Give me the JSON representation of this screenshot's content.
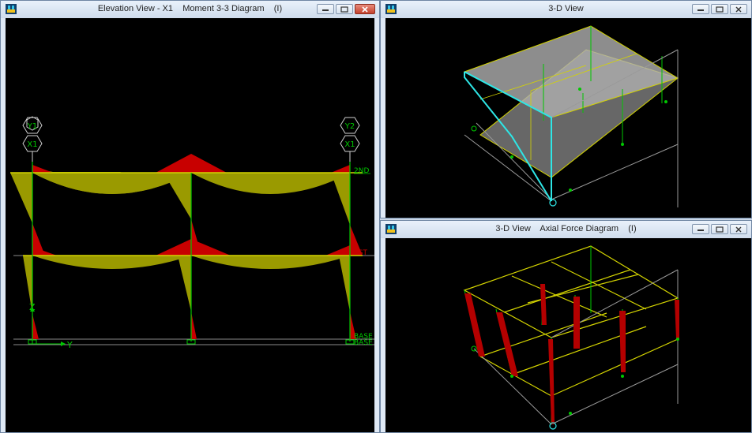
{
  "windows": {
    "elevation": {
      "title": "Elevation View - X1    Moment 3-3 Diagram    (I)",
      "grid_bubbles": [
        "Y1",
        "X1",
        "Y2",
        "X1"
      ],
      "story_labels": [
        "2ND",
        "1ST",
        "BASE",
        "BASE"
      ],
      "axes": {
        "vertical": "Z",
        "horizontal": "Y"
      }
    },
    "view3d_top": {
      "title": "3-D View"
    },
    "view3d_bottom": {
      "title": "3-D View    Axial Force Diagram    (I)"
    }
  },
  "colors": {
    "canvas_bg": "#000000",
    "frame_green": "#00c800",
    "moment_positive": "#9a9a00",
    "moment_negative": "#c80000",
    "slab_yellow": "#d4d400",
    "selected_cyan": "#2ee6e6",
    "axial_red": "#b40000"
  }
}
